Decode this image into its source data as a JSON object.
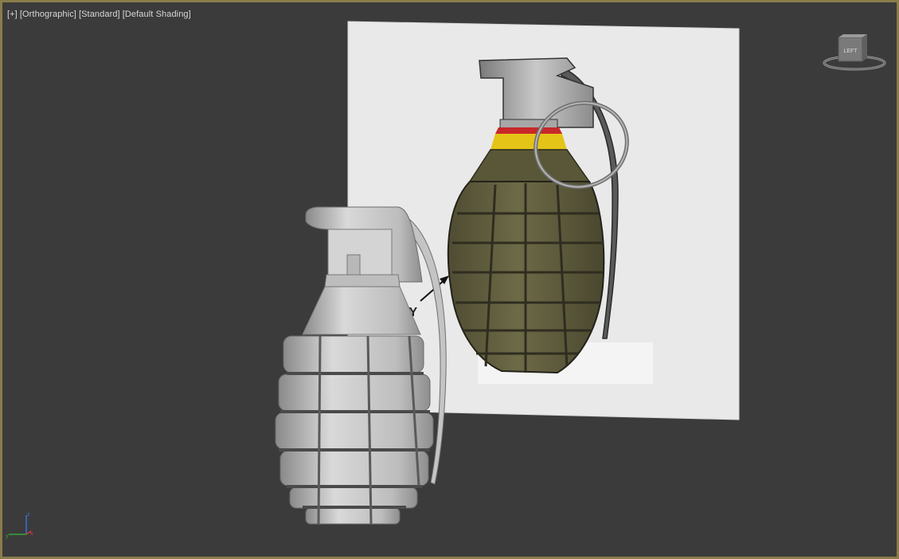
{
  "viewport": {
    "label_items": [
      "[+]",
      "[Orthographic]",
      "[Standard]",
      "[Default Shading]"
    ],
    "viewcube": {
      "face_label": "LEFT"
    },
    "axis_gizmo": {
      "axes": [
        "z",
        "y",
        "x"
      ]
    },
    "reference_image": {
      "caption": "DY"
    },
    "colors": {
      "background": "#3b3b3b",
      "border": "#8a7d4a",
      "label_text": "#d8d8d8"
    }
  }
}
